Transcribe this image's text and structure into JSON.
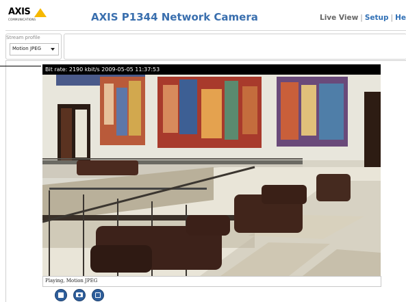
{
  "header": {
    "logo_text": "AXIS",
    "logo_subtext": "COMMUNICATIONS",
    "title": "AXIS P1344 Network Camera",
    "nav": {
      "live_view": "Live View",
      "separator": "|",
      "setup": "Setup",
      "help": "He"
    }
  },
  "stream_profile": {
    "label": "Stream profile",
    "selected": "Motion JPEG"
  },
  "video": {
    "overlay_text": "Bit rate:  2190 kbit/s 2009-05-05 11:37:53"
  },
  "status": {
    "text": "Playing, Motion JPEG"
  },
  "controls": {
    "icons": [
      "stop-icon",
      "snapshot-icon",
      "view-full-screen-icon"
    ]
  },
  "colors": {
    "title": "#3a6fae",
    "link": "#2f6fb5",
    "logo_accent": "#f6b800",
    "control_button": "#2f5f9c"
  }
}
